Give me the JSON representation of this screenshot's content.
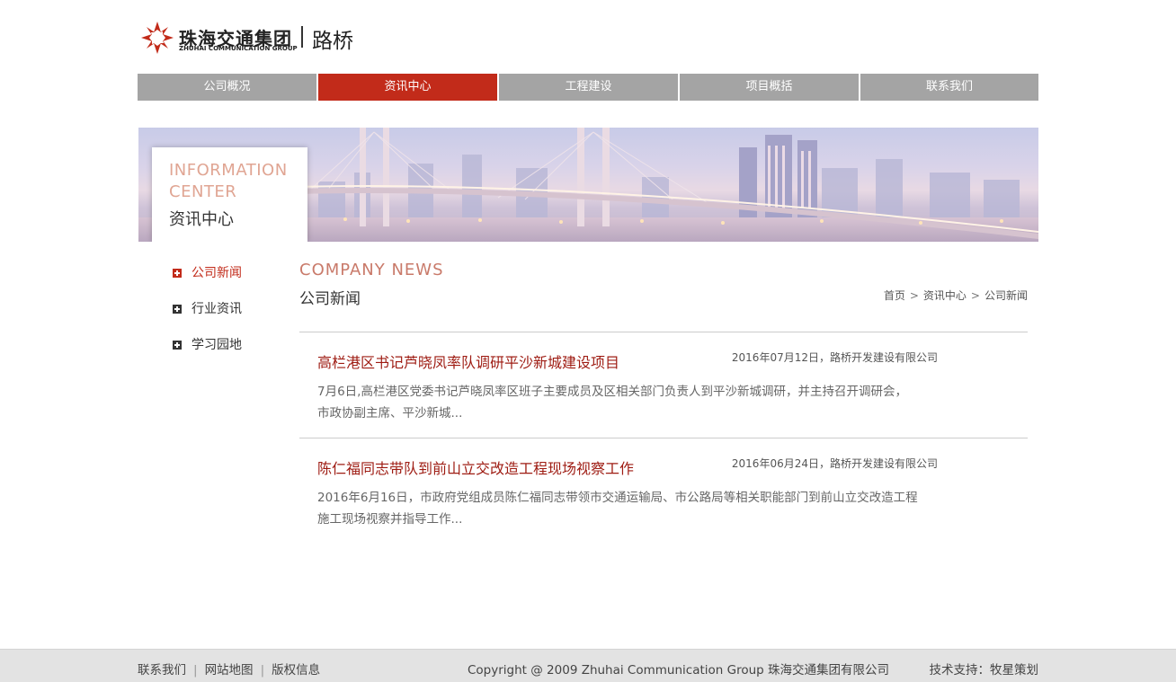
{
  "header": {
    "logo_cn": "珠海交通集团",
    "logo_en": "ZHUHAI COMMUNICATION GROUP",
    "logo_sub": "路桥",
    "brand_color": "#c22b1a"
  },
  "nav": {
    "items": [
      {
        "label": "公司概况"
      },
      {
        "label": "资讯中心"
      },
      {
        "label": "工程建设"
      },
      {
        "label": "项目概括"
      },
      {
        "label": "联系我们"
      }
    ],
    "active_index": 1
  },
  "banner": {
    "title_en_line1": "INFORMATION",
    "title_en_line2": "CENTER",
    "title_cn": "资讯中心"
  },
  "sidebar": {
    "items": [
      {
        "label": "公司新闻"
      },
      {
        "label": "行业资讯"
      },
      {
        "label": "学习园地"
      }
    ],
    "active_index": 0
  },
  "main": {
    "title_en": "COMPANY NEWS",
    "title_cn": "公司新闻",
    "breadcrumb": [
      "首页",
      "资讯中心",
      "公司新闻"
    ],
    "breadcrumb_separator": ">",
    "news": [
      {
        "title": "高栏港区书记芦晓凤率队调研平沙新城建设项目",
        "meta": "2016年07月12日，路桥开发建设有限公司",
        "summary_line1": "7月6日,高栏港区党委书记芦晓凤率区班子主要成员及区相关部门负责人到平沙新城调研，并主持召开调研会，",
        "summary_line2": "市政协副主席、平沙新城..."
      },
      {
        "title": "陈仁福同志带队到前山立交改造工程现场视察工作",
        "meta": "2016年06月24日，路桥开发建设有限公司",
        "summary_line1": "2016年6月16日，市政府党组成员陈仁福同志带领市交通运输局、市公路局等相关职能部门到前山立交改造工程",
        "summary_line2": "施工现场视察并指导工作..."
      }
    ]
  },
  "footer": {
    "links": [
      {
        "label": "联系我们"
      },
      {
        "label": "网站地图"
      },
      {
        "label": "版权信息"
      }
    ],
    "link_separator": "|",
    "copyright": "Copyright @ 2009 Zhuhai Communication Group 珠海交通集团有限公司",
    "support": "技术支持：牧星策划"
  }
}
